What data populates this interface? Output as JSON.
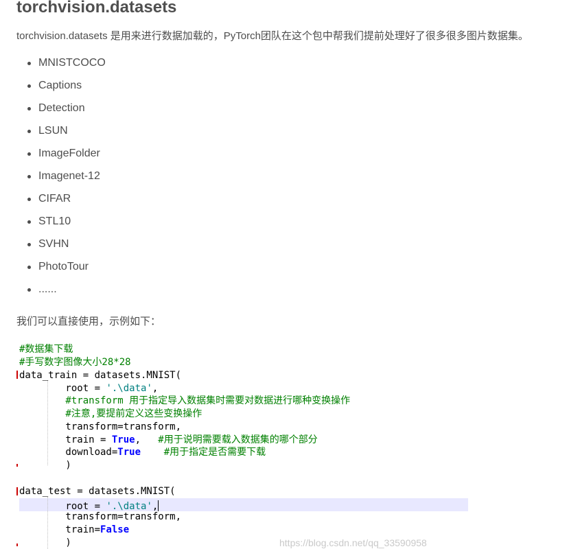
{
  "article": {
    "title": "torchvision.datasets",
    "intro": "torchvision.datasets 是用来进行数据加载的，PyTorch团队在这个包中帮我们提前处理好了很多很多图片数据集。",
    "datasets": [
      "MNISTCOCO",
      "Captions",
      "Detection",
      "LSUN",
      "ImageFolder",
      "Imagenet-12",
      "CIFAR",
      "STL10",
      "SVHN",
      "PhotoTour",
      "......"
    ],
    "usage_text": "我们可以直接使用，示例如下："
  },
  "code": {
    "lines": {
      "l1": "#数据集下载",
      "l2": "#手写数字图像大小28*28",
      "l3": "data_train = datasets.MNIST(",
      "l4a": "        root = ",
      "l4b": "'.\\data'",
      "l4c": ",",
      "l5": "        #transform 用于指定导入数据集时需要对数据进行哪种变换操作",
      "l6": "        #注意,要提前定义这些变换操作",
      "l7": "        transform=transform,",
      "l8a": "        train = ",
      "l8b": "True",
      "l8c": ",   ",
      "l8d": "#用于说明需要载入数据集的哪个部分",
      "l9a": "        download=",
      "l9b": "True",
      "l9c": "    ",
      "l9d": "#用于指定是否需要下载",
      "l10": "        )",
      "l12": "data_test = datasets.MNIST(",
      "l13a": "        root = ",
      "l13b": "'.\\data'",
      "l13c": ",",
      "l14": "        transform=transform,",
      "l15a": "        train=",
      "l15b": "False",
      "l16": "        )"
    }
  },
  "watermark": "https://blog.csdn.net/qq_33590958",
  "colors": {
    "comment": "#008000",
    "string": "#008080",
    "keyword": "#0000ff",
    "current_line_highlight": "#e8e8ff"
  }
}
